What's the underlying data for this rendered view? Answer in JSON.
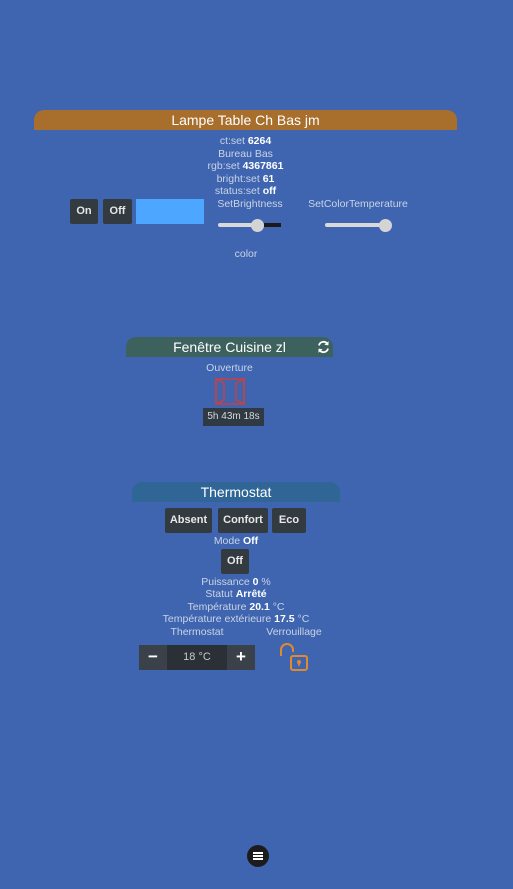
{
  "lamp": {
    "title": "Lampe Table Ch Bas jm",
    "ct_label": "ct:set",
    "ct_value": "6264",
    "room": "Bureau Bas",
    "rgb_label": "rgb:set",
    "rgb_value": "4367861",
    "bright_label": "bright:set",
    "bright_value": "61",
    "status_label": "status:set",
    "status_value": "off",
    "on_label": "On",
    "off_label": "Off",
    "swatch_color": "#4da6ff",
    "brightness_label": "SetBrightness",
    "brightness_level": 0.61,
    "colortemp_label": "SetColorTemperature",
    "colortemp_level": 1.0,
    "color_label": "color"
  },
  "window": {
    "title": "Fenêtre Cuisine zl",
    "refresh_icon": "refresh-icon",
    "opening_label": "Ouverture",
    "window_icon": "window-open-icon",
    "timer": "5h 43m 18s"
  },
  "thermostat": {
    "title": "Thermostat",
    "modes": [
      "Absent",
      "Confort",
      "Eco"
    ],
    "mode_label": "Mode",
    "mode_value": "Off",
    "off_label": "Off",
    "power_label": "Puissance",
    "power_value": "0",
    "power_unit": "%",
    "status_label": "Statut",
    "status_value": "Arrêté",
    "temp_label": "Température",
    "temp_value": "20.1",
    "temp_unit": "°C",
    "ext_label": "Température extérieure",
    "ext_value": "17.5",
    "ext_unit": "°C",
    "thermostat_label": "Thermostat",
    "lock_label": "Verrouillage",
    "minus": "−",
    "plus": "+",
    "setpoint": "18 °C"
  },
  "colors": {
    "background": "#3f65b0",
    "lamp_header": "#a86e2c",
    "window_header": "#3d625e",
    "thermo_header": "#2f6695",
    "lock_orange": "#e08a2e",
    "window_red": "#c94040"
  }
}
